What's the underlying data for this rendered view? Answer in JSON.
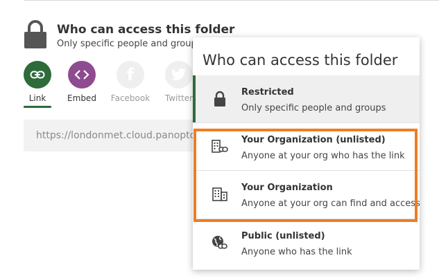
{
  "panel": {
    "title": "Who can access this folder",
    "subtitle": "Only specific people and groups",
    "share": [
      {
        "label": "Link",
        "icon": "link-icon",
        "color": "#2e6b3a"
      },
      {
        "label": "Embed",
        "icon": "code-icon",
        "color": "#8e4b8f"
      },
      {
        "label": "Facebook",
        "icon": "facebook-icon",
        "color": "#efefef"
      },
      {
        "label": "Twitter",
        "icon": "twitter-icon",
        "color": "#efefef"
      }
    ],
    "url": "https://londonmet.cloud.panopto.eu"
  },
  "popup": {
    "title": "Who can access this folder",
    "options": [
      {
        "title": "Restricted",
        "desc": "Only specific people and groups",
        "icon": "lock-icon",
        "selected": true
      },
      {
        "title": "Your Organization (unlisted)",
        "desc": "Anyone at your org who has the link",
        "icon": "org-link-icon"
      },
      {
        "title": "Your Organization",
        "desc": "Anyone at your org can find and access",
        "icon": "org-icon"
      },
      {
        "title": "Public (unlisted)",
        "desc": "Anyone who has the link",
        "icon": "globe-link-icon"
      }
    ]
  },
  "colors": {
    "accent": "#2e6b3a",
    "highlight": "#ef7d22",
    "embed": "#8e4b8f"
  }
}
